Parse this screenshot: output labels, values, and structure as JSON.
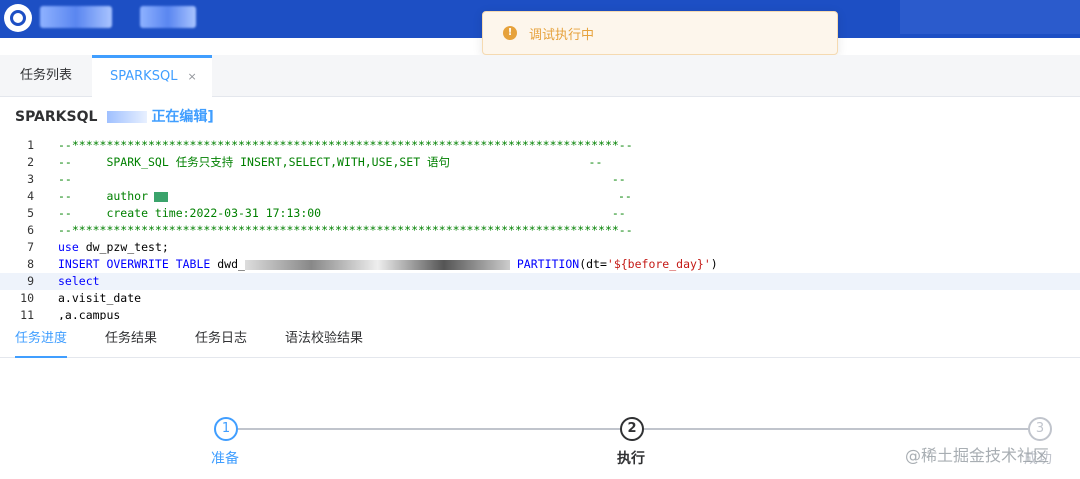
{
  "toast": {
    "icon": "warning-icon",
    "message": "调试执行中"
  },
  "tabs": [
    {
      "label": "任务列表"
    },
    {
      "label": "SPARKSQL",
      "close": "×"
    }
  ],
  "editor_title": {
    "name": "SPARKSQL",
    "status": "正在编辑]"
  },
  "code_lines": [
    {
      "n": "1",
      "text": "--*******************************************************************************--"
    },
    {
      "n": "2",
      "text": "--     SPARK_SQL 任务只支持 INSERT,SELECT,WITH,USE,SET 语句                    --"
    },
    {
      "n": "3",
      "text": "--                                                                              --"
    },
    {
      "n": "4",
      "text": "--     author"
    },
    {
      "n": "5",
      "text": "--     create time:2022-03-31 17:13:00                                          --"
    },
    {
      "n": "6",
      "text": "--*******************************************************************************--"
    },
    {
      "n": "7",
      "kw": "use",
      "rest": " dw_pzw_test;"
    },
    {
      "n": "8",
      "kw": "INSERT OVERWRITE TABLE",
      "mid": " dwd_",
      "rest2": " PARTITION",
      "paren": "(dt=",
      "str": "'${before_day}'",
      "end": ")"
    },
    {
      "n": "9",
      "kw": "select"
    },
    {
      "n": "10",
      "text": "a.visit_date"
    },
    {
      "n": "11",
      "text": ",a.campus"
    }
  ],
  "bottom_tabs": [
    "任务进度",
    "任务结果",
    "任务日志",
    "语法校验结果"
  ],
  "steps": [
    {
      "num": "1",
      "label": "准备"
    },
    {
      "num": "2",
      "label": "执行"
    },
    {
      "num": "3",
      "label": "成功"
    }
  ],
  "watermark": "@稀土掘金技术社区",
  "colors": {
    "topbar": "#1d4fc4",
    "accent": "#409eff",
    "warning": "#e6a23c"
  }
}
